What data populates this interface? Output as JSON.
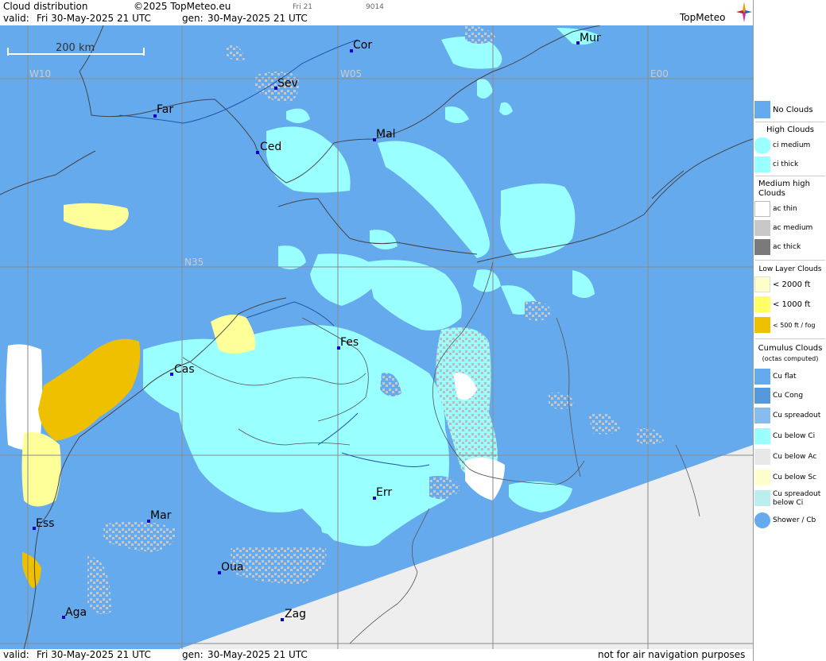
{
  "header": {
    "title": "Cloud distribution",
    "copyright": "©2025 TopMeteo.eu",
    "tab_small": "Fri 21",
    "code_small": "9014",
    "valid_label": "valid:",
    "valid_value": "Fri  30-May-2025  21 UTC",
    "gen_label": "gen:",
    "gen_value": "30-May-2025 21 UTC",
    "logo": "TopMeteo"
  },
  "footer": {
    "valid_label": "valid:",
    "valid_value": "Fri  30-May-2025  21 UTC",
    "gen_label": "gen:",
    "gen_value": "30-May-2025 21 UTC",
    "disclaimer": "not for air navigation purposes"
  },
  "map": {
    "scale_label": "200 km",
    "grid_labels": {
      "w10": "W10",
      "w05": "W05",
      "e00": "E00",
      "n35": "N35"
    },
    "cities": [
      {
        "name": "Cor"
      },
      {
        "name": "Mur"
      },
      {
        "name": "Sev"
      },
      {
        "name": "Far"
      },
      {
        "name": "Mal"
      },
      {
        "name": "Ced"
      },
      {
        "name": "Fes"
      },
      {
        "name": "Cas"
      },
      {
        "name": "Err"
      },
      {
        "name": "Mar"
      },
      {
        "name": "Ess"
      },
      {
        "name": "Oua"
      },
      {
        "name": "Aga"
      },
      {
        "name": "Zag"
      }
    ],
    "colors": {
      "no_clouds": "#66aaee",
      "ci": "#99ffff",
      "low_2000": "#ffff99",
      "low_500": "#eec000",
      "ac": "#c8c8c8",
      "nodata": "#eeeeee"
    }
  },
  "legend": {
    "no_clouds": "No Clouds",
    "high_header": "High Clouds",
    "ci_medium": "ci medium",
    "ci_thick": "ci thick",
    "mid_header": "Medium high Clouds",
    "ac_thin": "ac thin",
    "ac_medium": "ac medium",
    "ac_thick": "ac thick",
    "low_header": "Low Layer Clouds",
    "low_2000": "< 2000 ft",
    "low_1000": "< 1000 ft",
    "low_500": "< 500 ft / fog",
    "cu_header": "Cumulus Clouds",
    "cu_sub": "(octas computed)",
    "cu_flat": "Cu flat",
    "cu_cong": "Cu Cong",
    "cu_spreadout": "Cu spreadout",
    "cu_below_ci": "Cu below Ci",
    "cu_below_ac": "Cu below Ac",
    "cu_below_sc": "Cu below Sc",
    "cu_spread_below_ci_1": "Cu spreadout",
    "cu_spread_below_ci_2": "below Ci",
    "shower": "Shower / Cb"
  }
}
